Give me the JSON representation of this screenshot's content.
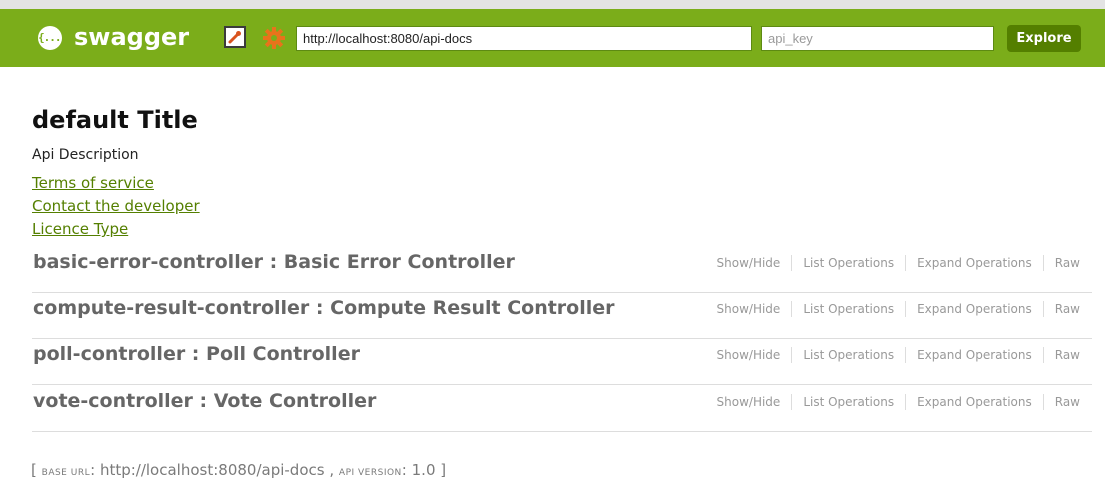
{
  "header": {
    "logo": "{...}",
    "brand": "swagger",
    "url_value": "http://localhost:8080/api-docs",
    "api_key_placeholder": "api_key",
    "explore_label": "Explore",
    "colors": {
      "bar": "#7bad1a",
      "button": "#547f00"
    },
    "icons": [
      "logo-icon",
      "edit-icon",
      "gear-icon"
    ]
  },
  "info": {
    "title": "default Title",
    "description": "Api Description",
    "links": [
      "Terms of service",
      "Contact the developer",
      "Licence Type"
    ]
  },
  "resources": [
    {
      "name": "basic-error-controller : Basic Error Controller"
    },
    {
      "name": "compute-result-controller : Compute Result Controller"
    },
    {
      "name": "poll-controller : Poll Controller"
    },
    {
      "name": "vote-controller : Vote Controller"
    }
  ],
  "ops": {
    "show_hide": "Show/Hide",
    "list": "List Operations",
    "expand": "Expand Operations",
    "raw": "Raw"
  },
  "footer": {
    "open": "[",
    "base_url_label": "base url",
    "colon": ":",
    "base_url": "http://localhost:8080/api-docs",
    "sep": ",",
    "api_version_label": "api version",
    "api_version": "1.0",
    "close": "]"
  }
}
